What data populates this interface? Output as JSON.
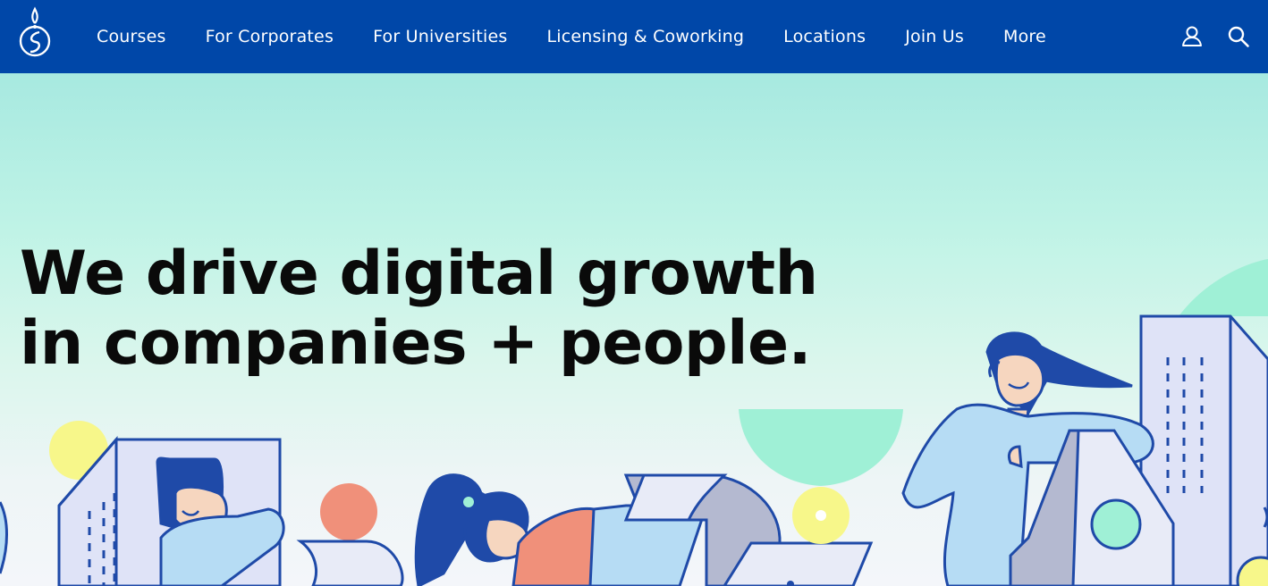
{
  "header": {
    "logo_icon": "general-assembly-logo-icon",
    "nav": [
      {
        "label": "Courses"
      },
      {
        "label": "For Corporates"
      },
      {
        "label": "For Universities"
      },
      {
        "label": "Licensing & Coworking"
      },
      {
        "label": "Locations"
      },
      {
        "label": "Join Us"
      },
      {
        "label": "More"
      }
    ],
    "icons": {
      "account": "user-icon",
      "search": "search-icon"
    }
  },
  "hero": {
    "headline_line1": "We drive digital growth",
    "headline_line2": "in companies + people."
  },
  "colors": {
    "brand_blue": "#0047a8",
    "headline": "#0a0a0a",
    "mint": "#a7e9e0",
    "outline_blue": "#1f4aa8"
  }
}
